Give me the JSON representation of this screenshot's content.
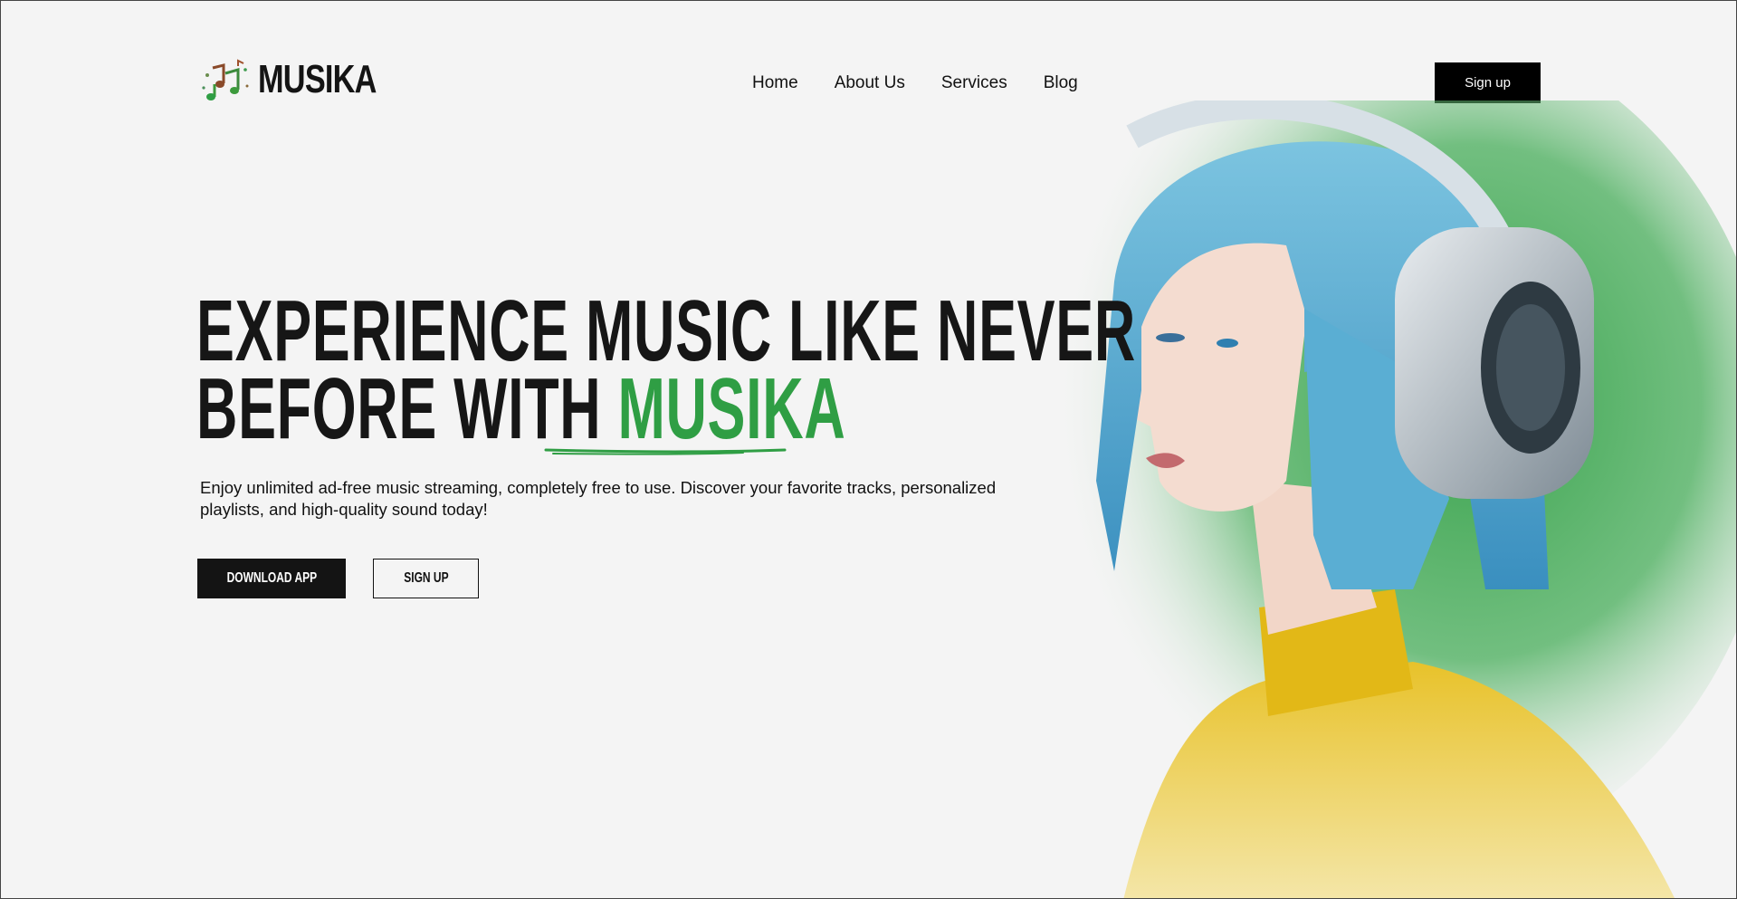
{
  "header": {
    "brand": "MUSIKA",
    "logo_icon": "music-notes-icon",
    "nav": [
      {
        "label": "Home"
      },
      {
        "label": "About Us"
      },
      {
        "label": "Services"
      },
      {
        "label": "Blog"
      }
    ],
    "signup_label": "Sign up"
  },
  "hero": {
    "headline_line1": "EXPERIENCE MUSIC LIKE NEVER",
    "headline_line2_prefix": "BEFORE WITH ",
    "headline_accent": "MUSIKA",
    "subtext": "Enjoy unlimited ad-free music streaming, completely free to use. Discover your favorite tracks, personalized playlists, and high-quality sound today!",
    "download_label": "DOWNLOAD APP",
    "signup_label": "SIGN UP"
  },
  "colors": {
    "accent": "#2f9e44",
    "button_dark": "#141414",
    "background": "#f4f4f4"
  }
}
